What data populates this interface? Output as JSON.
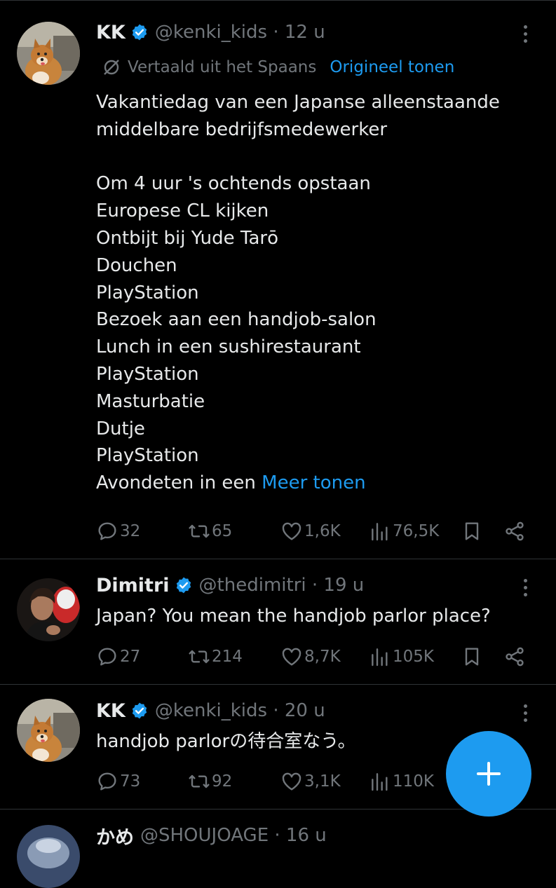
{
  "colors": {
    "background": "#000000",
    "text": "#e7e9ea",
    "muted": "#71767b",
    "accent": "#1d9bf0",
    "divider": "#2f3336"
  },
  "icons": [
    "verified-badge-icon",
    "more-options-icon",
    "translate-icon",
    "reply-icon",
    "retweet-icon",
    "like-icon",
    "views-icon",
    "bookmark-icon",
    "share-icon",
    "compose-plus-icon"
  ],
  "tweets": [
    {
      "name": "KK",
      "handle": "@kenki_kids · 12 u",
      "translation": {
        "label": "Vertaald uit het Spaans",
        "show_original": "Origineel tonen"
      },
      "lines": [
        "Vakantiedag van een Japanse alleenstaande",
        "middelbare bedrijfsmedewerker",
        "",
        "Om 4 uur 's ochtends opstaan",
        "Europese CL kijken",
        "Ontbijt bij Yude Tarō",
        "Douchen",
        "PlayStation",
        "Bezoek aan een handjob-salon",
        "Lunch in een sushirestaurant",
        "PlayStation",
        "Masturbatie",
        "Dutje",
        "PlayStation",
        "Avondeten in een "
      ],
      "more_link": "Meer tonen",
      "stats": {
        "replies": "32",
        "retweets": "65",
        "likes": "1,6K",
        "views": "76,5K"
      }
    },
    {
      "name": "Dimitri",
      "handle": "@thedimitri · 19 u",
      "lines": [
        "Japan? You mean the handjob parlor place?"
      ],
      "stats": {
        "replies": "27",
        "retweets": "214",
        "likes": "8,7K",
        "views": "105K"
      }
    },
    {
      "name": "KK",
      "handle": "@kenki_kids · 20 u",
      "lines": [
        "handjob parlorの待合室なう。"
      ],
      "stats": {
        "replies": "73",
        "retweets": "92",
        "likes": "3,1K",
        "views": "110K"
      }
    },
    {
      "name": "かめ",
      "handle": "@SHOUJOAGE · 16 u"
    }
  ]
}
